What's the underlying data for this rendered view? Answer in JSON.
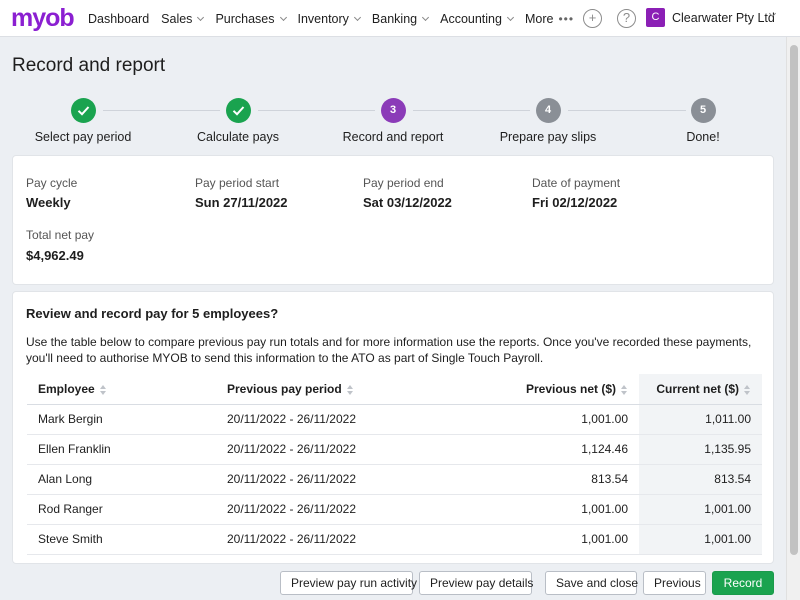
{
  "app": {
    "logo_text": "myob",
    "nav": [
      "Dashboard",
      "Sales",
      "Purchases",
      "Inventory",
      "Banking",
      "Accounting",
      "More"
    ],
    "business": {
      "avatar_letter": "C",
      "name": "Clearwater Pty Ltd"
    },
    "icons": {
      "add": "plus-circle-icon",
      "help": "help-circle-icon"
    }
  },
  "page_title": "Record and report",
  "steps": [
    {
      "number": "1",
      "label": "Select pay period",
      "state": "done"
    },
    {
      "number": "2",
      "label": "Calculate pays",
      "state": "done"
    },
    {
      "number": "3",
      "label": "Record and report",
      "state": "current"
    },
    {
      "number": "4",
      "label": "Prepare pay slips",
      "state": "pending"
    },
    {
      "number": "5",
      "label": "Done!",
      "state": "pending"
    }
  ],
  "summary": {
    "pay_cycle": {
      "label": "Pay cycle",
      "value": "Weekly"
    },
    "period_start": {
      "label": "Pay period start",
      "value": "Sun 27/11/2022"
    },
    "period_end": {
      "label": "Pay period end",
      "value": "Sat 03/12/2022"
    },
    "payment_date": {
      "label": "Date of payment",
      "value": "Fri 02/12/2022"
    },
    "total_net": {
      "label": "Total net pay",
      "value": "$4,962.49"
    }
  },
  "review": {
    "title": "Review and record pay for 5 employees?",
    "description": "Use the table below to compare previous pay run totals and for more information use the reports. Once you've recorded these payments, you'll need to authorise MYOB to send this information to the ATO as part of Single Touch Payroll.",
    "columns": [
      "Employee",
      "Previous pay period",
      "Previous net ($)",
      "Current net ($)"
    ],
    "rows": [
      [
        "Mark Bergin",
        "20/11/2022 - 26/11/2022",
        "1,001.00",
        "1,011.00"
      ],
      [
        "Ellen Franklin",
        "20/11/2022 - 26/11/2022",
        "1,124.46",
        "1,135.95"
      ],
      [
        "Alan Long",
        "20/11/2022 - 26/11/2022",
        "813.54",
        "813.54"
      ],
      [
        "Rod Ranger",
        "20/11/2022 - 26/11/2022",
        "1,001.00",
        "1,001.00"
      ],
      [
        "Steve Smith",
        "20/11/2022 - 26/11/2022",
        "1,001.00",
        "1,001.00"
      ]
    ]
  },
  "buttons": {
    "preview_activity": "Preview pay run activity",
    "preview_details": "Preview pay details",
    "save_close": "Save and close",
    "previous": "Previous",
    "record": "Record"
  },
  "colors": {
    "brand": "#8b1fd1",
    "step_done": "#1aa34f",
    "step_current": "#8b3bb8",
    "step_pending": "#8a8f96",
    "primary_button": "#1aa34f"
  }
}
